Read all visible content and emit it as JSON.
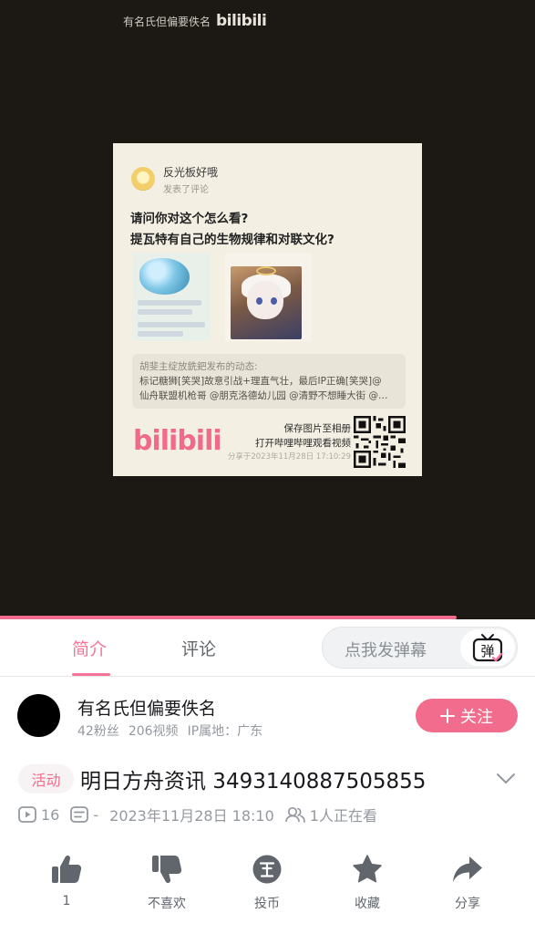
{
  "video": {
    "watermark_text": "有名氏但偏要佚名",
    "watermark_logo": "bilibili",
    "card": {
      "username": "反光板好哦",
      "action": "发表了评论",
      "question_line1": "请问你对这个怎么看?",
      "question_line2": "提瓦特有自己的生物规律和对联文化?",
      "quote_title": "胡斐主绽放銑鈀发布的动态:",
      "quote_line1": "标记糖狮[笑哭]故意引战+理直气壮，最后IP正确[笑哭]@",
      "quote_line2": "仙舟联盟机枪哥 @朋克洛德幼儿园 @清野不想睡大街 @…",
      "logo": "bilibili",
      "save_line1": "保存图片至相册",
      "save_line2": "打开哔哩哔哩观看视频",
      "share_time": "分享于2023年11月28日 17:10:29"
    }
  },
  "tabs": {
    "intro": "简介",
    "comments": "评论",
    "danmaku_placeholder": "点我发弹幕",
    "danmaku_icon": "弹"
  },
  "uploader": {
    "name": "有名氏但偏要佚名",
    "fans": "42粉丝",
    "videos": "206视频",
    "ip": "IP属地：广东",
    "follow_label": "关注"
  },
  "video_info": {
    "tag": "活动",
    "title": "明日方舟资讯 3493140887505855",
    "plays": "16",
    "danmaku_count": "-",
    "date": "2023年11月28日 18:10",
    "watching": "1人正在看"
  },
  "actions": {
    "like": "1",
    "dislike": "不喜欢",
    "coin": "投币",
    "favorite": "收藏",
    "share": "分享"
  },
  "colors": {
    "accent": "#fb7299",
    "video_bg": "#1c1813",
    "icon": "#61666d"
  }
}
